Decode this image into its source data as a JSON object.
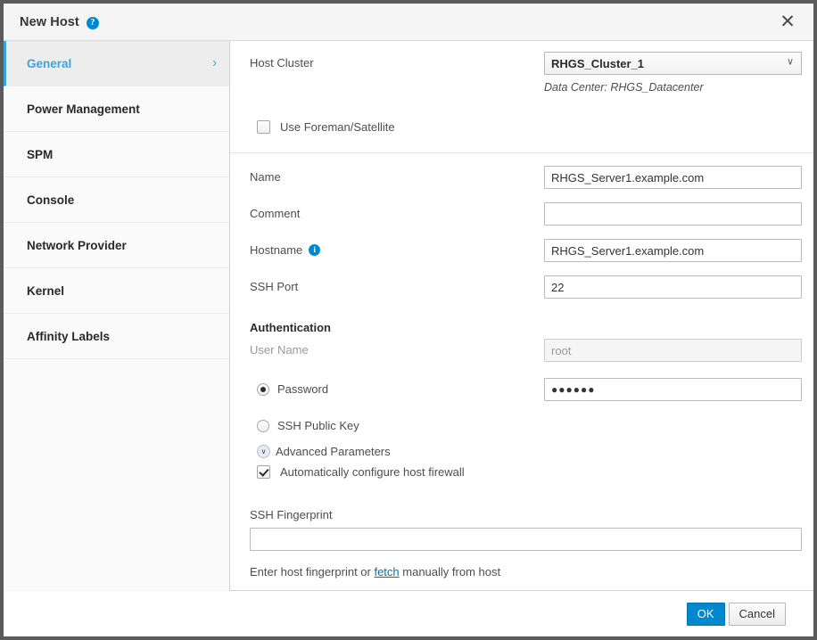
{
  "window": {
    "title": "New Host",
    "help_icon": "help-circle-icon",
    "close_label": "✕"
  },
  "sidebar": {
    "items": [
      {
        "label": "General",
        "active": true,
        "chevron": "›"
      },
      {
        "label": "Power Management",
        "active": false
      },
      {
        "label": "SPM",
        "active": false
      },
      {
        "label": "Console",
        "active": false
      },
      {
        "label": "Network Provider",
        "active": false
      },
      {
        "label": "Kernel",
        "active": false
      },
      {
        "label": "Affinity Labels",
        "active": false
      }
    ]
  },
  "form": {
    "host_cluster": {
      "label": "Host Cluster",
      "value": "RHGS_Cluster_1",
      "caret": "∨",
      "datacenter_hint": "Data Center: RHGS_Datacenter"
    },
    "foreman": {
      "label": "Use Foreman/Satellite",
      "checked": false
    },
    "name": {
      "label": "Name",
      "value": "RHGS_Server1.example.com",
      "placeholder": ""
    },
    "comment": {
      "label": "Comment",
      "value": "",
      "placeholder": ""
    },
    "hostname": {
      "label": "Hostname",
      "info_icon": "info-circle-icon",
      "value": "RHGS_Server1.example.com",
      "placeholder": ""
    },
    "ssh_port": {
      "label": "SSH Port",
      "value": "22",
      "placeholder": ""
    },
    "authentication": {
      "heading": "Authentication",
      "user_name": {
        "label": "User Name",
        "value": "",
        "placeholder": "root",
        "disabled": true
      },
      "password": {
        "label": "Password",
        "selected": true,
        "value": "●●●●●●"
      },
      "ssh_public_key": {
        "label": "SSH Public Key",
        "selected": false
      },
      "advanced_parameters": {
        "label": "Advanced Parameters",
        "expanded": true,
        "caret": "∨"
      },
      "auto_firewall": {
        "label": "Automatically configure host firewall",
        "checked": true
      }
    },
    "ssh_fingerprint": {
      "label": "SSH Fingerprint",
      "value": "",
      "placeholder": "",
      "hint_prefix": "Enter host fingerprint or ",
      "hint_link": "fetch",
      "hint_suffix": " manually from host"
    }
  },
  "footer": {
    "ok_label": "OK",
    "cancel_label": "Cancel"
  },
  "colors": {
    "accent": "#0088ce",
    "active_nav": "#39a5dc",
    "link": "#0071ab"
  }
}
